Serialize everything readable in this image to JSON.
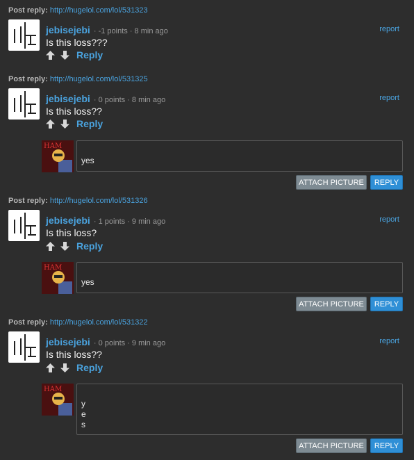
{
  "comments": [
    {
      "post_reply_label": "Post reply:",
      "post_url": "http://hugelol.com/lol/531323",
      "username": "jebisejebi",
      "meta": "· -1 points · 8 min ago",
      "report_label": "report",
      "text": "Is this loss???",
      "reply_label": "Reply"
    },
    {
      "post_reply_label": "Post reply:",
      "post_url": "http://hugelol.com/lol/531325",
      "username": "jebisejebi",
      "meta": "· 0 points · 8 min ago",
      "report_label": "report",
      "text": "Is this loss??",
      "reply_label": "Reply",
      "reply_form": {
        "text": "yes",
        "attach_label": "ATTACH PICTURE",
        "reply_button_label": "REPLY"
      }
    },
    {
      "post_reply_label": "Post reply:",
      "post_url": "http://hugelol.com/lol/531326",
      "username": "jebisejebi",
      "meta": "· 1 points · 9 min ago",
      "report_label": "report",
      "text": "Is this loss?",
      "reply_label": "Reply",
      "reply_form": {
        "text": "yes",
        "attach_label": "ATTACH PICTURE",
        "reply_button_label": "REPLY"
      }
    },
    {
      "post_reply_label": "Post reply:",
      "post_url": "http://hugelol.com/lol/531322",
      "username": "jebisejebi",
      "meta": "· 0 points · 9 min ago",
      "report_label": "report",
      "text": "Is this loss??",
      "reply_label": "Reply",
      "reply_form": {
        "text": "y\ne\ns",
        "attach_label": "ATTACH PICTURE",
        "reply_button_label": "REPLY"
      }
    }
  ],
  "user_pic_caption": "HAM",
  "colors": {
    "background": "#2d2d2d",
    "link": "#4aa3df",
    "reply_button": "#2f8fd6",
    "attach_button": "#7e8b93"
  },
  "icons": [
    "loss-avatar-icon",
    "upvote-arrow-icon",
    "downvote-arrow-icon",
    "user-picture",
    "resize-grip-icon"
  ]
}
